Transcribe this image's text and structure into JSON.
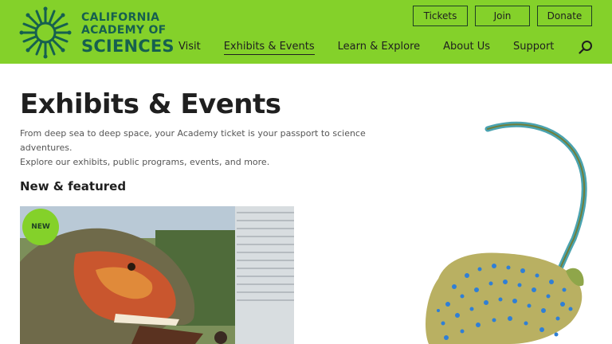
{
  "logo": {
    "line1": "CALIFORNIA",
    "line2": "ACADEMY OF",
    "line3": "SCIENCES"
  },
  "top_buttons": {
    "tickets": "Tickets",
    "join": "Join",
    "donate": "Donate"
  },
  "nav": {
    "items": [
      "Visit",
      "Exhibits & Events",
      "Learn & Explore",
      "About Us",
      "Support"
    ],
    "active": "Exhibits & Events"
  },
  "main": {
    "title": "Exhibits & Events",
    "intro_line1": "From deep sea to deep space, your Academy ticket is your passport to science adventures.",
    "intro_line2": "Explore our exhibits, public programs, events, and more.",
    "section_title": "New & featured",
    "feature_badge": "NEW"
  },
  "colors": {
    "brand_green": "#84d12a",
    "brand_dark": "#16604f",
    "text": "#1f1f1f"
  },
  "icons": {
    "search": "search-icon",
    "logo": "academy-logo-icon"
  }
}
